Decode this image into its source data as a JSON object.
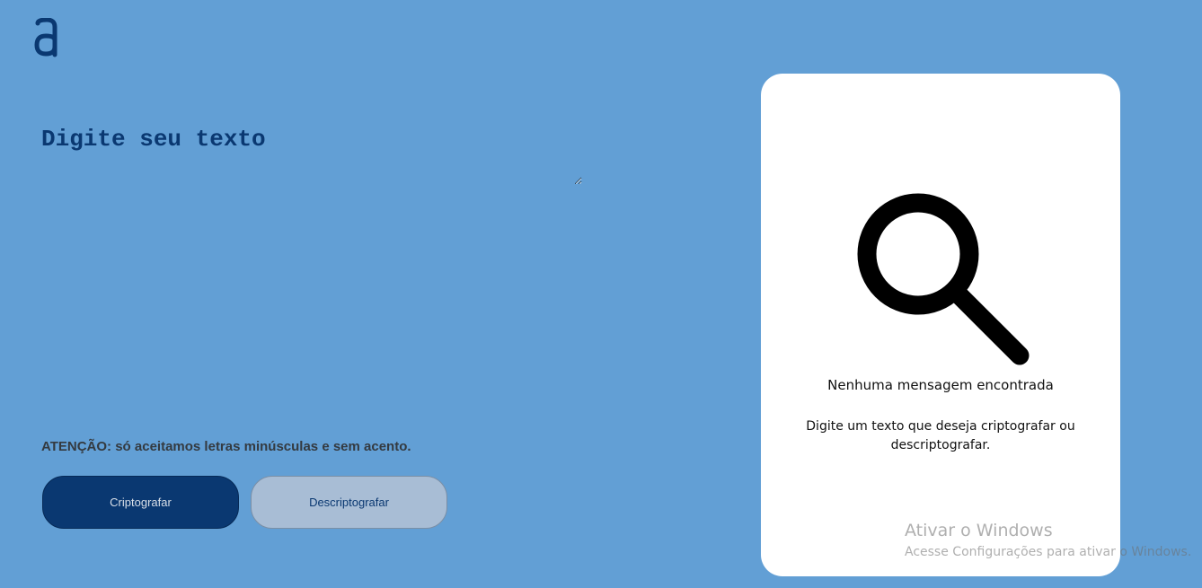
{
  "logo": {
    "icon": "alura-a-logo-icon",
    "color": "#0a3871"
  },
  "editor": {
    "placeholder": "Digite seu texto",
    "value": ""
  },
  "warning": {
    "text": "ATENÇÃO: só aceitamos letras minúsculas e sem acento."
  },
  "buttons": {
    "encrypt_label": "Criptografar",
    "decrypt_label": "Descriptografar"
  },
  "result_panel": {
    "illustration_icon": "magnifying-glass-icon",
    "title": "Nenhuma mensagem encontrada",
    "subtitle": "Digite um texto que deseja criptografar ou descriptografar."
  },
  "windows_watermark": {
    "title": "Ativar o Windows",
    "subtitle": "Acesse Configurações para ativar o Windows."
  },
  "colors": {
    "background": "#629fd5",
    "primary": "#0a3871",
    "secondary_button": "#a8bdd5",
    "panel": "#ffffff"
  }
}
